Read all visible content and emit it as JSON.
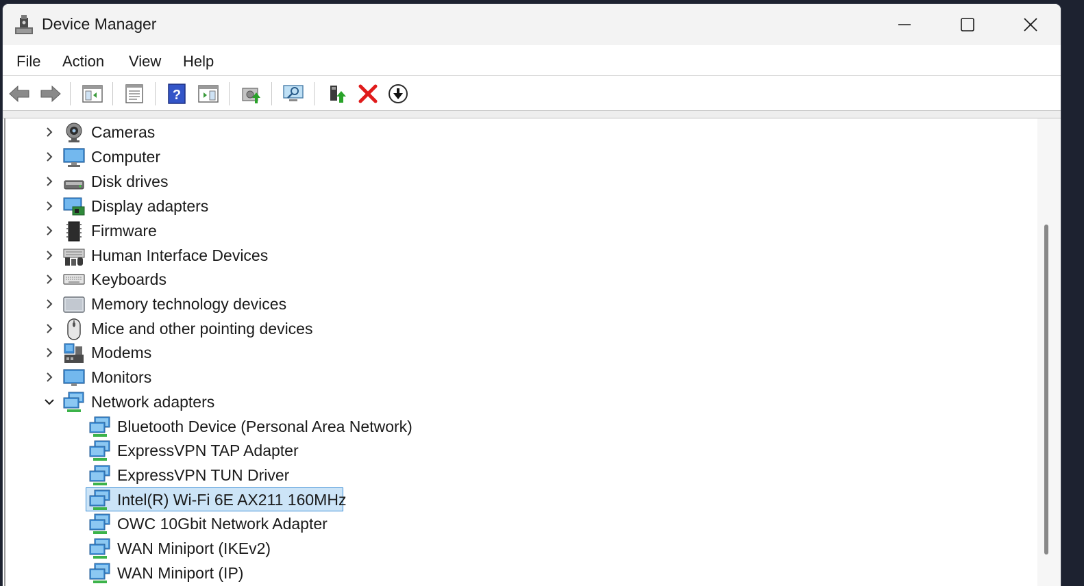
{
  "window": {
    "title": "Device Manager",
    "icon": "device-manager-icon",
    "controls": [
      "minimize-icon",
      "maximize-icon",
      "close-icon"
    ]
  },
  "menu": {
    "file": "File",
    "action": "Action",
    "view": "View",
    "help": "Help"
  },
  "toolbar": {
    "icons": [
      "back-icon",
      "forward-icon",
      "show-hide-console-tree-icon",
      "properties-icon",
      "help-icon",
      "action-pane-icon",
      "update-driver-icon",
      "scan-hardware-changes-icon",
      "enable-device-icon",
      "uninstall-device-icon",
      "disable-device-icon"
    ]
  },
  "tree": {
    "categories": [
      {
        "label": "Cameras",
        "icon": "camera-icon",
        "expanded": false
      },
      {
        "label": "Computer",
        "icon": "computer-icon",
        "expanded": false
      },
      {
        "label": "Disk drives",
        "icon": "disk-drive-icon",
        "expanded": false
      },
      {
        "label": "Display adapters",
        "icon": "display-adapter-icon",
        "expanded": false
      },
      {
        "label": "Firmware",
        "icon": "firmware-icon",
        "expanded": false
      },
      {
        "label": "Human Interface Devices",
        "icon": "hid-icon",
        "expanded": false
      },
      {
        "label": "Keyboards",
        "icon": "keyboard-icon",
        "expanded": false
      },
      {
        "label": "Memory technology devices",
        "icon": "memory-device-icon",
        "expanded": false
      },
      {
        "label": "Mice and other pointing devices",
        "icon": "mouse-icon",
        "expanded": false
      },
      {
        "label": "Modems",
        "icon": "modem-icon",
        "expanded": false
      },
      {
        "label": "Monitors",
        "icon": "monitor-icon",
        "expanded": false
      },
      {
        "label": "Network adapters",
        "icon": "network-adapter-icon",
        "expanded": true
      }
    ],
    "network_adapters": [
      {
        "label": "Bluetooth Device (Personal Area Network)",
        "selected": false
      },
      {
        "label": "ExpressVPN TAP Adapter",
        "selected": false
      },
      {
        "label": "ExpressVPN TUN Driver",
        "selected": false
      },
      {
        "label": "Intel(R) Wi-Fi 6E AX211 160MHz",
        "selected": true
      },
      {
        "label": "OWC 10Gbit Network Adapter",
        "selected": false
      },
      {
        "label": "WAN Miniport (IKEv2)",
        "selected": false
      },
      {
        "label": "WAN Miniport (IP)",
        "selected": false
      }
    ]
  },
  "colors": {
    "selection_fill": "#cce4f7",
    "selection_border": "#3d8fd6",
    "uninstall_red": "#e01b1b"
  }
}
